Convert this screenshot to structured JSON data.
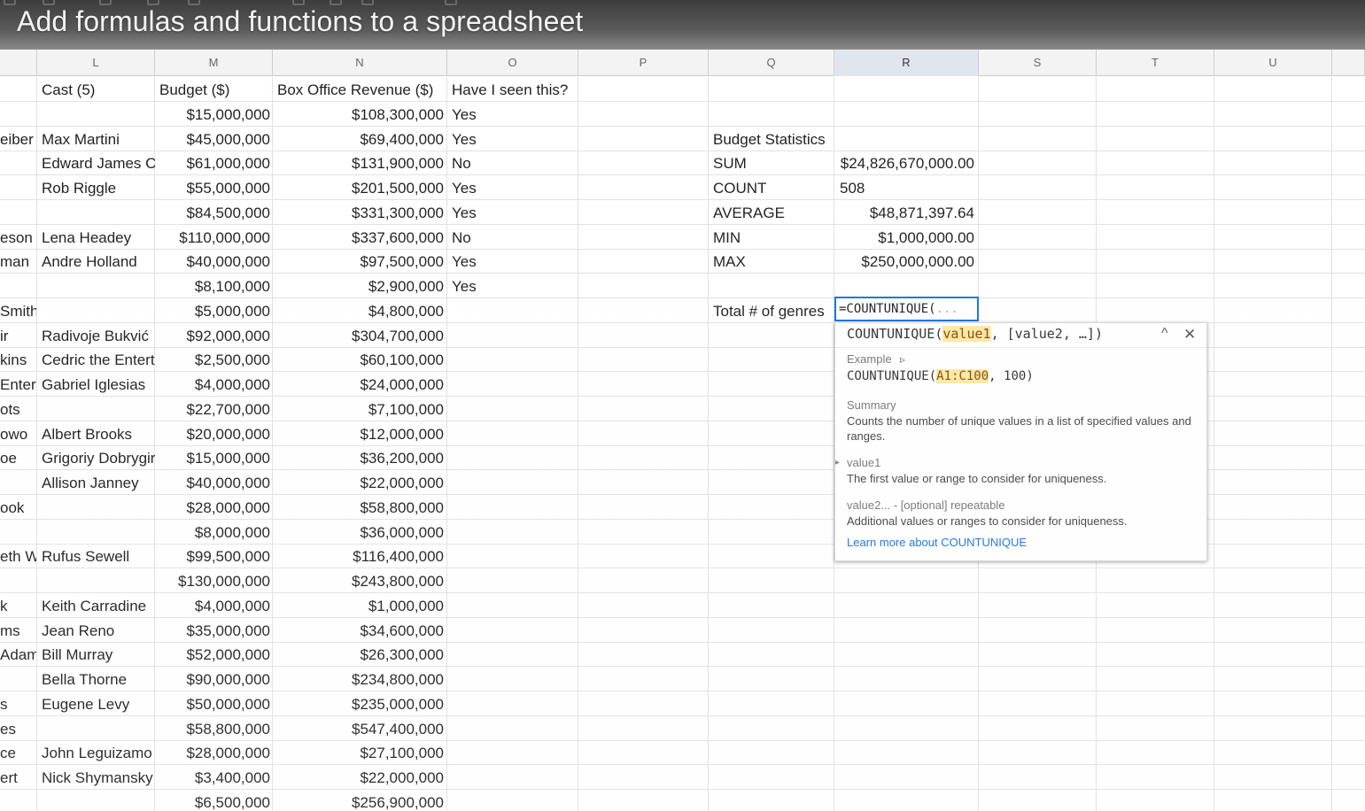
{
  "video_title": "Add formulas and functions to a spreadsheet",
  "columns": [
    "L",
    "M",
    "N",
    "O",
    "P",
    "Q",
    "R",
    "S",
    "T",
    "U"
  ],
  "active_column": "R",
  "headers": {
    "cast": "Cast (5)",
    "budget": "Budget ($)",
    "revenue": "Box Office Revenue ($)",
    "seen": "Have I seen this?"
  },
  "rows": [
    {
      "k": "",
      "cast": "",
      "budget": "$15,000,000",
      "revenue": "$108,300,000",
      "seen": "Yes"
    },
    {
      "k": "eiber",
      "cast": "Max Martini",
      "budget": "$45,000,000",
      "revenue": "$69,400,000",
      "seen": "Yes"
    },
    {
      "k": "",
      "cast": "Edward James C",
      "budget": "$61,000,000",
      "revenue": "$131,900,000",
      "seen": "No"
    },
    {
      "k": "",
      "cast": "Rob Riggle",
      "budget": "$55,000,000",
      "revenue": "$201,500,000",
      "seen": "Yes"
    },
    {
      "k": "",
      "cast": "",
      "budget": "$84,500,000",
      "revenue": "$331,300,000",
      "seen": "Yes"
    },
    {
      "k": "eson",
      "cast": "Lena Headey",
      "budget": "$110,000,000",
      "revenue": "$337,600,000",
      "seen": "No"
    },
    {
      "k": "man",
      "cast": "Andre Holland",
      "budget": "$40,000,000",
      "revenue": "$97,500,000",
      "seen": "Yes"
    },
    {
      "k": "",
      "cast": "",
      "budget": "$8,100,000",
      "revenue": "$2,900,000",
      "seen": "Yes"
    },
    {
      "k": " Smith",
      "cast": "",
      "budget": "$5,000,000",
      "revenue": "$4,800,000",
      "seen": ""
    },
    {
      "k": "ir",
      "cast": "Radivoje Bukvić",
      "budget": "$92,000,000",
      "revenue": "$304,700,000",
      "seen": ""
    },
    {
      "k": "kins",
      "cast": "Cedric the Entert",
      "budget": "$2,500,000",
      "revenue": "$60,100,000",
      "seen": ""
    },
    {
      "k": "Entert",
      "cast": "Gabriel Iglesias",
      "budget": "$4,000,000",
      "revenue": "$24,000,000",
      "seen": ""
    },
    {
      "k": "ots",
      "cast": "",
      "budget": "$22,700,000",
      "revenue": "$7,100,000",
      "seen": ""
    },
    {
      "k": "owo",
      "cast": "Albert Brooks",
      "budget": "$20,000,000",
      "revenue": "$12,000,000",
      "seen": ""
    },
    {
      "k": "oe",
      "cast": "Grigoriy Dobrygir",
      "budget": "$15,000,000",
      "revenue": "$36,200,000",
      "seen": ""
    },
    {
      "k": "",
      "cast": "Allison Janney",
      "budget": "$40,000,000",
      "revenue": "$22,000,000",
      "seen": ""
    },
    {
      "k": "ook",
      "cast": "",
      "budget": "$28,000,000",
      "revenue": "$58,800,000",
      "seen": ""
    },
    {
      "k": "",
      "cast": "",
      "budget": "$8,000,000",
      "revenue": "$36,000,000",
      "seen": ""
    },
    {
      "k": "eth W",
      "cast": "Rufus Sewell",
      "budget": "$99,500,000",
      "revenue": "$116,400,000",
      "seen": ""
    },
    {
      "k": "",
      "cast": "",
      "budget": "$130,000,000",
      "revenue": "$243,800,000",
      "seen": ""
    },
    {
      "k": "k",
      "cast": "Keith Carradine",
      "budget": "$4,000,000",
      "revenue": "$1,000,000",
      "seen": ""
    },
    {
      "k": "ms",
      "cast": "Jean Reno",
      "budget": "$35,000,000",
      "revenue": "$34,600,000",
      "seen": ""
    },
    {
      "k": "Adams",
      "cast": "Bill Murray",
      "budget": "$52,000,000",
      "revenue": "$26,300,000",
      "seen": ""
    },
    {
      "k": "",
      "cast": "Bella Thorne",
      "budget": "$90,000,000",
      "revenue": "$234,800,000",
      "seen": ""
    },
    {
      "k": "s",
      "cast": "Eugene Levy",
      "budget": "$50,000,000",
      "revenue": "$235,000,000",
      "seen": ""
    },
    {
      "k": "es",
      "cast": "",
      "budget": "$58,800,000",
      "revenue": "$547,400,000",
      "seen": ""
    },
    {
      "k": "ce",
      "cast": "John Leguizamo",
      "budget": "$28,000,000",
      "revenue": "$27,100,000",
      "seen": ""
    },
    {
      "k": "ert",
      "cast": "Nick Shymansky",
      "budget": "$3,400,000",
      "revenue": "$22,000,000",
      "seen": ""
    },
    {
      "k": "",
      "cast": "",
      "budget": "$6,500,000",
      "revenue": "$256,900,000",
      "seen": ""
    }
  ],
  "stats": {
    "title": "Budget Statistics",
    "items": [
      {
        "label": "SUM",
        "value": "$24,826,670,000.00"
      },
      {
        "label": "COUNT",
        "value": "508"
      },
      {
        "label": "AVERAGE",
        "value": "$48,871,397.64"
      },
      {
        "label": "MIN",
        "value": "$1,000,000.00"
      },
      {
        "label": "MAX",
        "value": "$250,000,000.00"
      }
    ],
    "genres_label": "Total # of genres",
    "formula_input": "=COUNTUNIQUE(",
    "formula_hint": "..."
  },
  "help": {
    "signature_name": "COUNTUNIQUE(",
    "signature_param": "value1",
    "signature_rest": ", [value2, …])",
    "collapse_glyph": "^",
    "close_glyph": "✕",
    "example_label": "Example",
    "example_prefix": "COUNTUNIQUE(",
    "example_range": "A1:C100",
    "example_suffix": ", 100)",
    "summary_label": "Summary",
    "summary_text": "Counts the number of unique values in a list of specified values and ranges.",
    "param1_name": "value1",
    "param1_desc": "The first value or range to consider for uniqueness.",
    "param2_name": "value2... - [optional] repeatable",
    "param2_desc": "Additional values or ranges to consider for uniqueness.",
    "learn_more": "Learn more about COUNTUNIQUE",
    "arrow_glyph": "▸"
  },
  "colors": {
    "accent": "#1a73e8",
    "highlight": "#fce8a6"
  }
}
